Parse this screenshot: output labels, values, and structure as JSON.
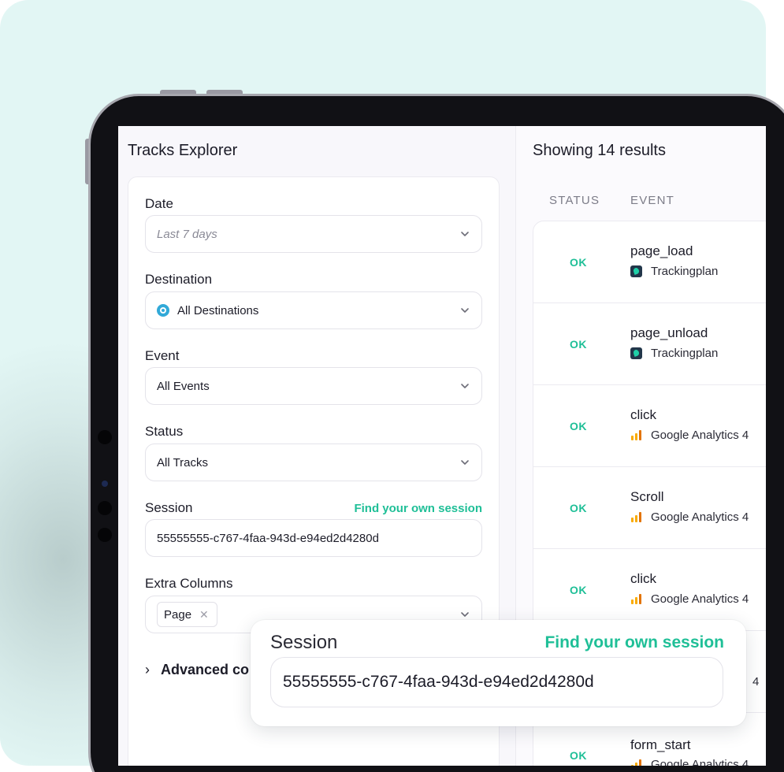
{
  "left_panel": {
    "title": "Tracks Explorer",
    "date": {
      "label": "Date",
      "placeholder": "Last 7 days"
    },
    "destination": {
      "label": "Destination",
      "value": "All Destinations"
    },
    "event": {
      "label": "Event",
      "value": "All Events"
    },
    "status": {
      "label": "Status",
      "value": "All Tracks"
    },
    "session": {
      "label": "Session",
      "link": "Find your own session",
      "value": "55555555-c767-4faa-943d-e94ed2d4280d"
    },
    "extra_columns": {
      "label": "Extra Columns",
      "chip": "Page",
      "chip_remove": "✕"
    },
    "advanced": {
      "arrow": "›",
      "label": "Advanced co"
    }
  },
  "results": {
    "title": "Showing 14 results",
    "columns": {
      "status": "STATUS",
      "event": "EVENT"
    },
    "rows": [
      {
        "status": "OK",
        "event": "page_load",
        "destination": "Trackingplan",
        "icon": "trackingplan-icon"
      },
      {
        "status": "OK",
        "event": "page_unload",
        "destination": "Trackingplan",
        "icon": "trackingplan-icon"
      },
      {
        "status": "OK",
        "event": "click",
        "destination": "Google Analytics 4",
        "icon": "google-analytics-icon"
      },
      {
        "status": "OK",
        "event": "Scroll",
        "destination": "Google Analytics 4",
        "icon": "google-analytics-icon"
      },
      {
        "status": "OK",
        "event": "click",
        "destination": "Google Analytics 4",
        "icon": "google-analytics-icon"
      },
      {
        "status": "",
        "event": "",
        "destination": "4",
        "icon": ""
      },
      {
        "status": "OK",
        "event": "form_start",
        "destination": "Google Analytics 4",
        "icon": "google-analytics-icon"
      }
    ]
  },
  "popup": {
    "label": "Session",
    "link": "Find your own session",
    "value": "55555555-c767-4faa-943d-e94ed2d4280d"
  },
  "colors": {
    "background": "#e2f6f4",
    "accent_green": "#1fbf97",
    "device_frame": "#111115"
  }
}
